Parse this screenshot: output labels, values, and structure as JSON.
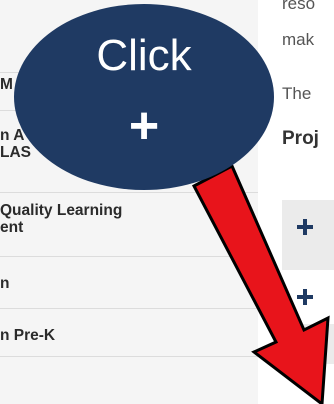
{
  "sidebar": {
    "items": [
      {
        "lines": [
          "M"
        ]
      },
      {
        "lines": [
          "n A",
          "LAS"
        ]
      },
      {
        "lines": [
          "Quality Learning",
          "ent"
        ]
      },
      {
        "lines": [
          "n"
        ]
      },
      {
        "lines": [
          "n Pre-K"
        ]
      },
      {
        "lines": [
          ""
        ]
      }
    ]
  },
  "main": {
    "text_lines": [
      "reso",
      "mak",
      "The"
    ],
    "heading": "Proj",
    "accordion_icon": "plus-icon"
  },
  "callout": {
    "title": "Click",
    "symbol": "+",
    "fill": "#1f3a63",
    "arrow_color": "#e8141b"
  }
}
